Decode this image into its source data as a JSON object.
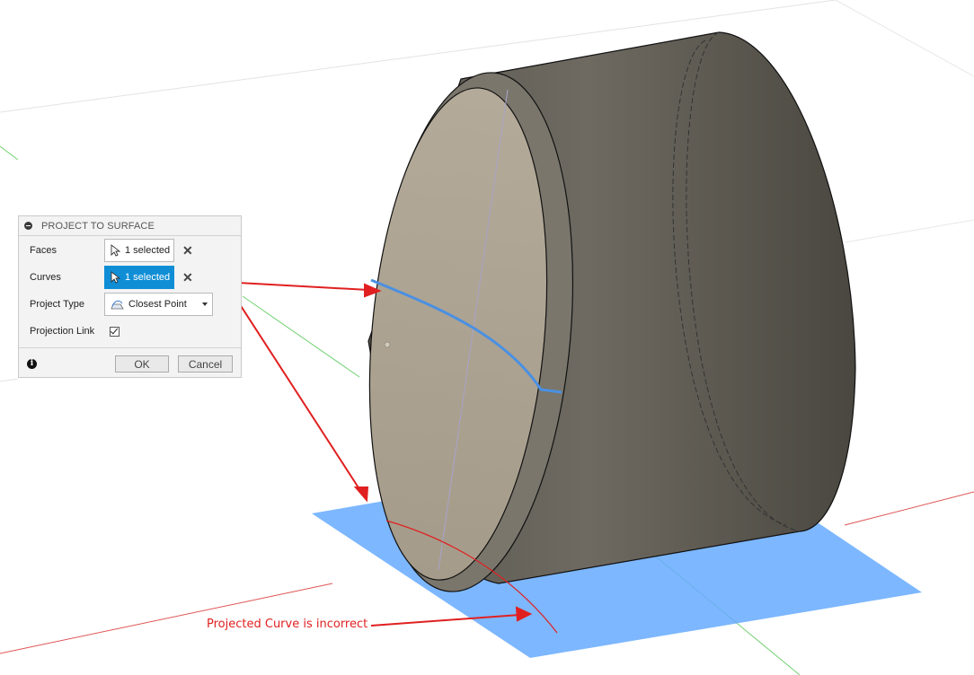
{
  "dialog": {
    "title": "PROJECT TO SURFACE",
    "faces_label": "Faces",
    "faces_value": "1 selected",
    "curves_label": "Curves",
    "curves_value": "1 selected",
    "project_type_label": "Project Type",
    "project_type_value": "Closest Point",
    "projection_link_label": "Projection Link",
    "projection_link_checked": true,
    "ok_label": "OK",
    "cancel_label": "Cancel"
  },
  "annotation": {
    "text": "Projected Curve is incorrect"
  },
  "colors": {
    "accent": "#0f8ed6",
    "annotation_red": "#e02020",
    "plane_blue": "#5aa6ff",
    "curve_blue": "#4a90e2"
  },
  "icons": [
    "collapse-icon",
    "cursor-icon",
    "close-icon",
    "closest-point-icon",
    "chevron-down-icon",
    "check-icon",
    "info-icon"
  ]
}
